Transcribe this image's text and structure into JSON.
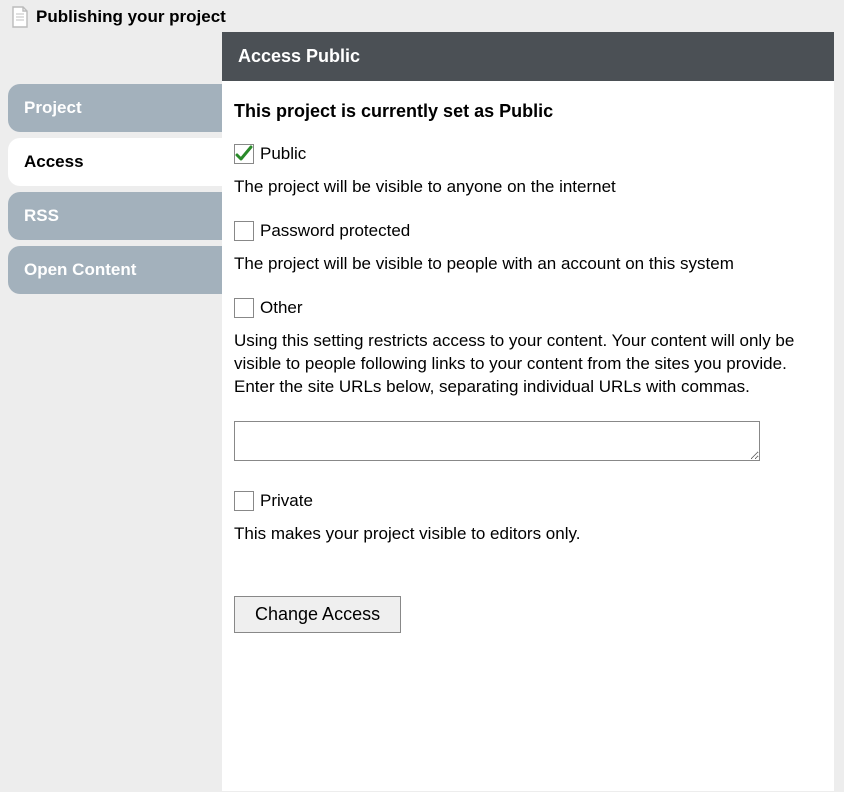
{
  "header": {
    "title": "Publishing your project"
  },
  "sidebar": {
    "tabs": [
      {
        "label": "Project"
      },
      {
        "label": "Access"
      },
      {
        "label": "RSS"
      },
      {
        "label": "Open Content"
      }
    ]
  },
  "panel": {
    "banner": "Access Public",
    "heading": "This project is currently set as Public",
    "options": {
      "public": {
        "label": "Public",
        "checked": true,
        "description": "The project will be visible to anyone on the internet"
      },
      "password": {
        "label": "Password protected",
        "checked": false,
        "description": "The project will be visible to people with an account on this system"
      },
      "other": {
        "label": "Other",
        "checked": false,
        "description": "Using this setting restricts access to your content. Your content will only be visible to people following links to your content from the sites you provide. Enter the site URLs below, separating individual URLs with commas."
      },
      "private": {
        "label": "Private",
        "checked": false,
        "description": "This makes your project visible to editors only."
      }
    },
    "urls_value": "",
    "submit_label": "Change Access"
  }
}
